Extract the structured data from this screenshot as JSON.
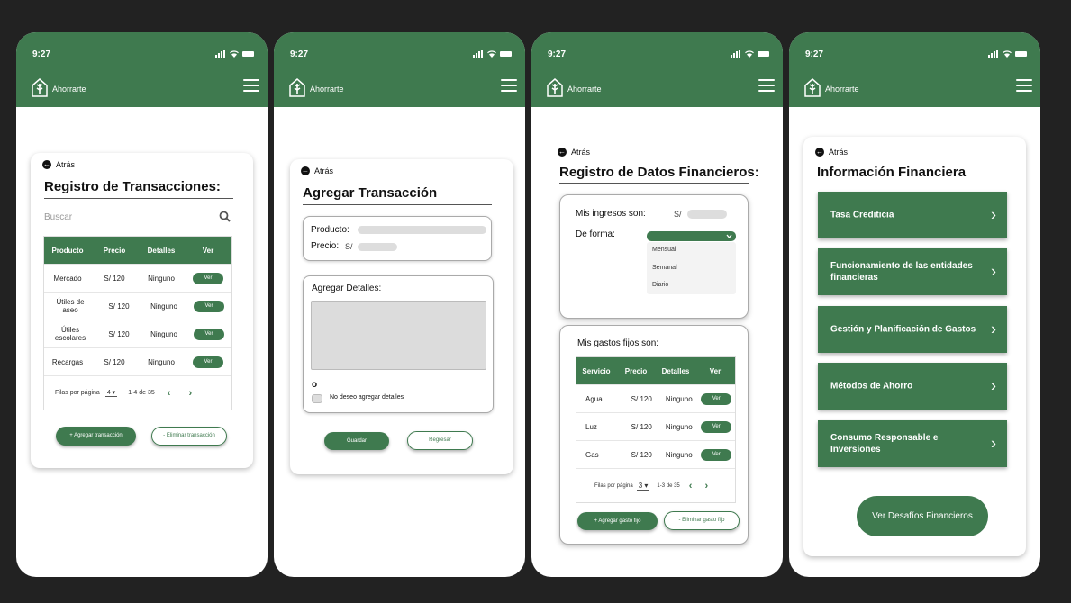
{
  "app": {
    "time": "9:27",
    "brand": "Ahorrarte",
    "back_label": "Atrás",
    "accent_color": "#3f7a4f"
  },
  "screen1": {
    "title": "Registro de Transacciones:",
    "search_placeholder": "Buscar",
    "columns": [
      "Producto",
      "Precio",
      "Detalles",
      "Ver"
    ],
    "rows": [
      {
        "producto": "Mercado",
        "precio": "S/ 120",
        "detalles": "Ninguno",
        "ver": "Ver"
      },
      {
        "producto": "Útiles de aseo",
        "precio": "S/ 120",
        "detalles": "Ninguno",
        "ver": "Ver"
      },
      {
        "producto": "Útiles escolares",
        "precio": "S/ 120",
        "detalles": "Ninguno",
        "ver": "Ver"
      },
      {
        "producto": "Recargas",
        "precio": "S/ 120",
        "detalles": "Ninguno",
        "ver": "Ver"
      }
    ],
    "rows_per_page_label": "Filas por página",
    "rows_per_page": "4",
    "range": "1-4 de 35",
    "add_button": "Agregar  transacción",
    "delete_button": "Eliminar transacción"
  },
  "screen2": {
    "title": "Agregar Transacción",
    "product_label": "Producto:",
    "price_label": "Precio:",
    "currency": "S/",
    "details_label": "Agregar Detalles:",
    "or_label": "o",
    "no_details_label": "No deseo agregar detalles",
    "save_button": "Guardar",
    "back_button": "Regresar"
  },
  "screen3": {
    "title": "Registro de Datos Financieros:",
    "income_label": "Mis ingresos son:",
    "currency": "S/",
    "frequency_label": "De forma:",
    "frequency_options": [
      "Mensual",
      "Semanal",
      "Diario"
    ],
    "fixed_expenses_label": "Mis gastos fijos son:",
    "columns": [
      "Servicio",
      "Precio",
      "Detalles",
      "Ver"
    ],
    "rows": [
      {
        "servicio": "Agua",
        "precio": "S/ 120",
        "detalles": "Ninguno",
        "ver": "Ver"
      },
      {
        "servicio": "Luz",
        "precio": "S/ 120",
        "detalles": "Ninguno",
        "ver": "Ver"
      },
      {
        "servicio": "Gas",
        "precio": "S/ 120",
        "detalles": "Ninguno",
        "ver": "Ver"
      }
    ],
    "rows_per_page_label": "Filas por página",
    "rows_per_page": "3",
    "range": "1-3 de 35",
    "add_button": "Agregar  gasto fijo",
    "delete_button": "Eliminar gasto fijo"
  },
  "screen4": {
    "title": "Información Financiera",
    "topics": [
      "Tasa Crediticia",
      "Funcionamiento de las entidades financieras",
      "Gestión y Planificación de Gastos",
      "Métodos de Ahorro",
      "Consumo Responsable e Inversiones"
    ],
    "challenges_button": "Ver Desafíos Financieros"
  }
}
